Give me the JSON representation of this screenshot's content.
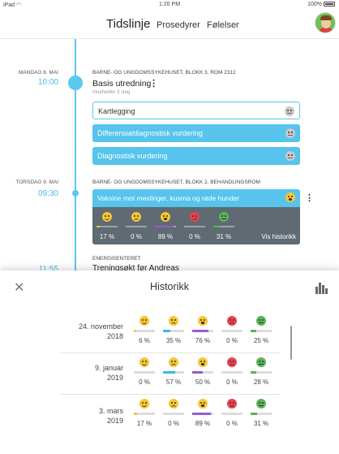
{
  "status_bar": {
    "device": "iPad",
    "time": "1:20 PM",
    "battery": "100%"
  },
  "nav": {
    "tabs": [
      {
        "label": "Tidslinje",
        "active": true
      },
      {
        "label": "Prosedyrer"
      },
      {
        "label": "Følelser"
      }
    ]
  },
  "colors": {
    "accent": "#56c4ec",
    "panel": "#5f6a72",
    "happy": "#f7c631",
    "sad": "#3fb8e8",
    "scared": "#9c59d1",
    "angry": "#e8424f",
    "sick": "#57b457"
  },
  "timeline": {
    "events": [
      {
        "date": "MANDAG 6. MAI",
        "time": "10:00",
        "location": "BARNE- OG UNGDOMSSYKEHUSET, BLOKK 3, ROM 2312",
        "title": "Basis utredning",
        "subtitle": "Inneholder 3 steg",
        "steps": [
          {
            "label": "Kartlegging",
            "icon": "neutral-emoji-icon"
          },
          {
            "label": "Differensialdiagnostisk vurdering",
            "icon": "neutral-emoji-icon"
          },
          {
            "label": "Diagnostisk vurdering",
            "icon": "neutral-emoji-icon"
          }
        ]
      },
      {
        "date": "TORSDAG 9. MAI",
        "time": "09:30",
        "location": "BARNE- OG UNGDOMSSYKEHUSET, BLOKK 2, BEHANDLINGSROM",
        "title": "Vaksine mot meslinger, kusma og røde hunder",
        "feelings": [
          {
            "emotion": "happy",
            "percent": "17 %",
            "value": 17
          },
          {
            "emotion": "sad",
            "percent": "0 %",
            "value": 0
          },
          {
            "emotion": "scared",
            "percent": "89 %",
            "value": 89
          },
          {
            "emotion": "angry",
            "percent": "0 %",
            "value": 0
          },
          {
            "emotion": "sick",
            "percent": "31 %",
            "value": 31
          }
        ],
        "history_link": "Vis historikk"
      },
      {
        "time": "11:55",
        "location": "ENERGISENTERET",
        "title": "Treningsøkt før Andreas"
      }
    ]
  },
  "history": {
    "title": "Historikk",
    "rows": [
      {
        "date_line1": "24. november",
        "date_line2": "2018",
        "values": [
          {
            "emotion": "happy",
            "percent": "6 %",
            "value": 6
          },
          {
            "emotion": "sad",
            "percent": "35 %",
            "value": 35
          },
          {
            "emotion": "scared",
            "percent": "76 %",
            "value": 76
          },
          {
            "emotion": "angry",
            "percent": "0 %",
            "value": 0
          },
          {
            "emotion": "sick",
            "percent": "25 %",
            "value": 25
          }
        ]
      },
      {
        "date_line1": "9. januar",
        "date_line2": "2019",
        "values": [
          {
            "emotion": "happy",
            "percent": "0 %",
            "value": 0
          },
          {
            "emotion": "sad",
            "percent": "57 %",
            "value": 57
          },
          {
            "emotion": "scared",
            "percent": "50 %",
            "value": 50
          },
          {
            "emotion": "angry",
            "percent": "0 %",
            "value": 0
          },
          {
            "emotion": "sick",
            "percent": "28 %",
            "value": 28
          }
        ]
      },
      {
        "date_line1": "3. mars",
        "date_line2": "2019",
        "values": [
          {
            "emotion": "happy",
            "percent": "17 %",
            "value": 17
          },
          {
            "emotion": "sad",
            "percent": "0 %",
            "value": 0
          },
          {
            "emotion": "scared",
            "percent": "89 %",
            "value": 89
          },
          {
            "emotion": "angry",
            "percent": "0 %",
            "value": 0
          },
          {
            "emotion": "sick",
            "percent": "31 %",
            "value": 31
          }
        ]
      }
    ]
  }
}
